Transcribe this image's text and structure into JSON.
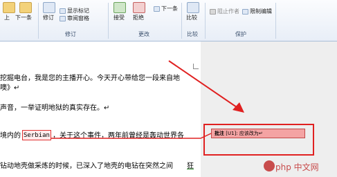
{
  "ribbon": {
    "top_row": {
      "prev_label": "上",
      "next_label": "下一条",
      "track_label": "修订",
      "show_markup_label": "显示标记",
      "reviewing_pane_label": "审阅窗格",
      "accept_label": "接受",
      "reject_label": "拒绝",
      "next_change_label": "下一条",
      "compare_label": "比较",
      "block_authors_label": "阻止作者",
      "restrict_label": "限制编辑"
    },
    "groups": {
      "tracking": "修订",
      "changes": "更改",
      "compare": "比较",
      "protect": "保护"
    }
  },
  "document": {
    "lines": [
      "挖掘电台，我是您的主播开心。今天开心带给您一段来自地",
      "噢》↵",
      "声音，一举证明地狱的真实存在。↵",
      "境内的",
      "Serbian",
      "，关于这个事件，两年前曾经是轰动世界各",
      "钻动地壳做采炼的时候，已深入了地壳的电钻在突然之间",
      "狂"
    ]
  },
  "comment": {
    "label": "批注",
    "ref": "[U1]:",
    "text": "应该改为↵"
  },
  "watermark": {
    "text": "php 中文网"
  },
  "colors": {
    "accent_red": "#e02020",
    "comment_fill": "#f4a3a3",
    "ribbon_border": "#a9bdd7"
  }
}
